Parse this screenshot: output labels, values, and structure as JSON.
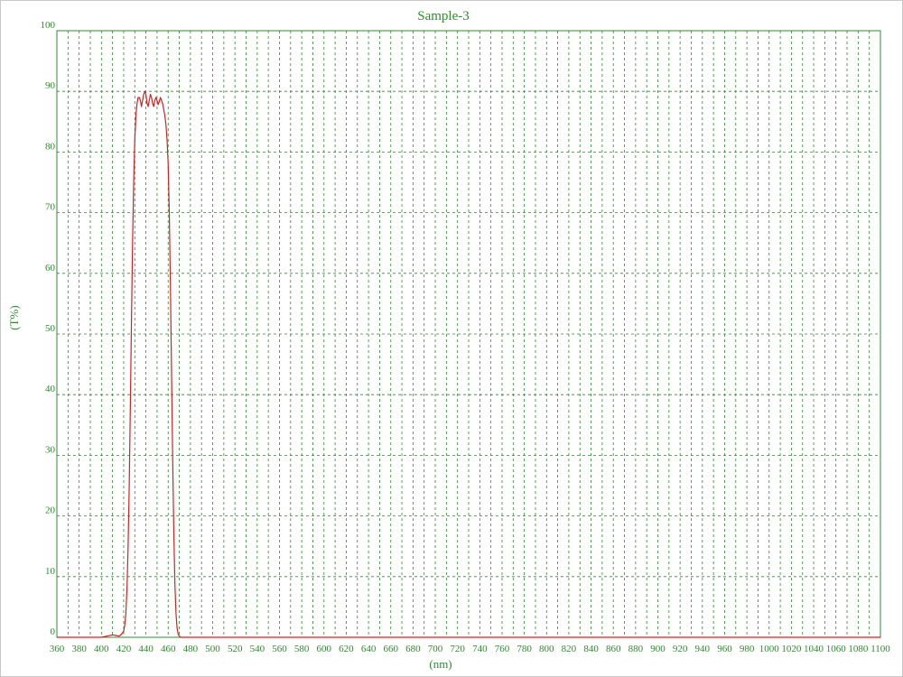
{
  "chart_data": {
    "type": "line",
    "title": "Sample-3",
    "xlabel": "(nm)",
    "ylabel": "(T%)",
    "xlim": [
      360,
      1100
    ],
    "ylim": [
      0,
      100
    ],
    "grid": true,
    "x_ticks": [
      360,
      380,
      400,
      420,
      440,
      460,
      480,
      500,
      520,
      540,
      560,
      580,
      600,
      620,
      640,
      660,
      680,
      700,
      720,
      740,
      760,
      780,
      800,
      820,
      840,
      860,
      880,
      900,
      920,
      940,
      960,
      980,
      1000,
      1020,
      1040,
      1060,
      1080,
      1100
    ],
    "y_ticks": [
      0,
      10,
      20,
      30,
      40,
      50,
      60,
      70,
      80,
      90,
      100
    ],
    "series": [
      {
        "color": "#d42020",
        "x": [
          360,
          400,
          405,
          410,
          413,
          416,
          418,
          420,
          421,
          422,
          423,
          424,
          425,
          426,
          427,
          428,
          429,
          430,
          431,
          432,
          433,
          434,
          435,
          436,
          437,
          438,
          439,
          440,
          441,
          442,
          443,
          444,
          445,
          446,
          447,
          448,
          449,
          450,
          451,
          452,
          453,
          454,
          455,
          456,
          457,
          458,
          459,
          460,
          461,
          462,
          463,
          464,
          465,
          466,
          467,
          468,
          469,
          470,
          471,
          472,
          473,
          474,
          475,
          476,
          477,
          480,
          500,
          1100
        ],
        "y": [
          0,
          0,
          0.2,
          0.4,
          0.3,
          0.2,
          0.5,
          1,
          2,
          4,
          8,
          15,
          25,
          38,
          52,
          65,
          75,
          82,
          86,
          88,
          89,
          89,
          88.5,
          87.5,
          88.5,
          89.5,
          90,
          89.5,
          88,
          87.5,
          88.5,
          89.5,
          89,
          88,
          87.5,
          88.5,
          89,
          88.5,
          87.8,
          88.3,
          89,
          88.5,
          88,
          87,
          86,
          84.5,
          82,
          78,
          70,
          58,
          44,
          30,
          18,
          9,
          4,
          1.5,
          0.5,
          0.2,
          0,
          0,
          0,
          0,
          0,
          0,
          0,
          0,
          0,
          0
        ]
      }
    ]
  }
}
